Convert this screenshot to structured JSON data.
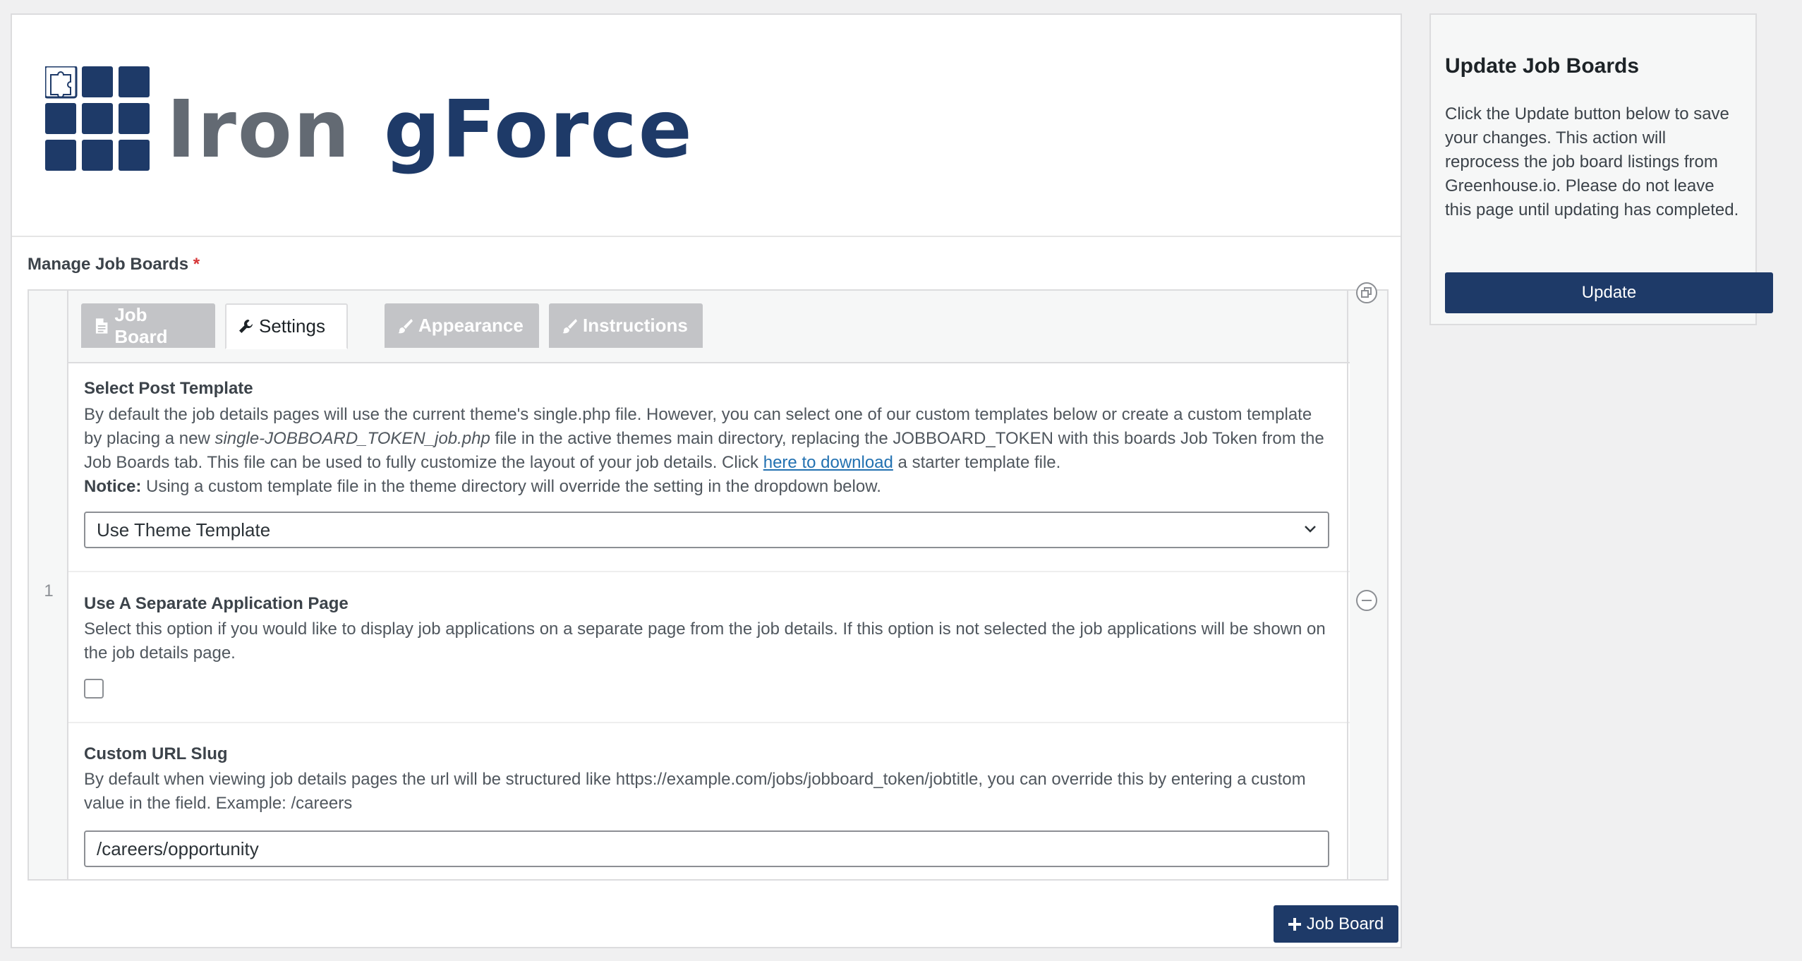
{
  "logo": {
    "text_part1": "Iron",
    "text_part2": "gForce",
    "colors": {
      "navy": "#1e3a68",
      "gray": "#636a73"
    }
  },
  "field": {
    "label": "Manage Job Boards",
    "required_mark": "*"
  },
  "repeater": {
    "row_number": "1",
    "tabs": [
      {
        "label": "Job Board",
        "icon": "document-icon"
      },
      {
        "label": "Settings",
        "icon": "wrench-icon"
      },
      {
        "label": "Appearance",
        "icon": "brush-icon"
      },
      {
        "label": "Instructions",
        "icon": "brush-icon"
      }
    ]
  },
  "settings": {
    "post_template": {
      "title": "Select Post Template",
      "desc_1": "By default the job details pages will use the current theme's single.php file. However, you can select one of our custom templates below or create a custom template by placing a new",
      "desc_filename": "single-JOBBOARD_TOKEN_job.php",
      "desc_2": "file in the active themes main directory, replacing the JOBBOARD_TOKEN with this boards Job Token from the Job Boards tab. This file can be used to fully customize the layout of your job details. Click",
      "desc_link": "here to download",
      "desc_3": "a starter template file.",
      "notice_label": "Notice:",
      "notice_text": "Using a custom template file in the theme directory will override the setting in the dropdown below.",
      "select_value": "Use Theme Template"
    },
    "separate_page": {
      "title": "Use A Separate Application Page",
      "desc": "Select this option if you would like to display job applications on a separate page from the job details. If this option is not selected the job applications will be shown on the job details page.",
      "checked": false
    },
    "url_slug": {
      "title": "Custom URL Slug",
      "desc": "By default when viewing job details pages the url will be structured like https://example.com/jobs/jobboard_token/jobtitle, you can override this by entering a custom value in the field. Example: /careers",
      "value": "/careers/opportunity"
    }
  },
  "add_button": {
    "label": "Job Board",
    "icon": "plus-icon"
  },
  "side_panel": {
    "title": "Update Job Boards",
    "desc": "Click the Update button below to save your changes. This action will reprocess the job board listings from Greenhouse.io. Please do not leave this page until updating has completed.",
    "button": "Update"
  }
}
